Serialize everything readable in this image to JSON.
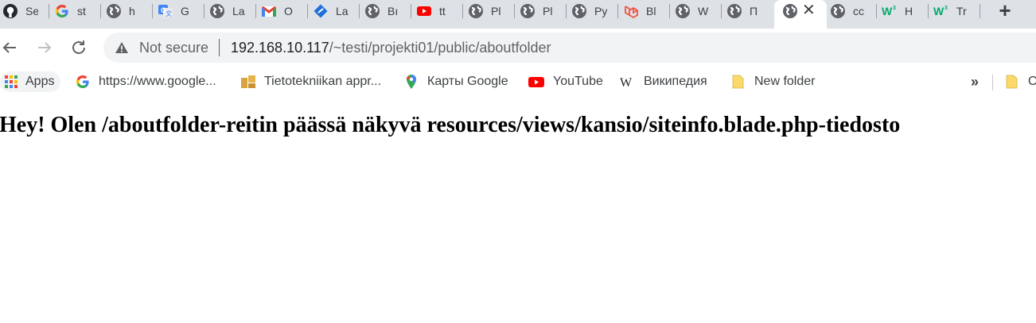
{
  "tabs": [
    {
      "title": "Se",
      "icon": "github-icon"
    },
    {
      "title": "st",
      "icon": "google-icon"
    },
    {
      "title": "h",
      "icon": "globe-icon"
    },
    {
      "title": "G",
      "icon": "google-translate-icon"
    },
    {
      "title": "La",
      "icon": "globe-icon"
    },
    {
      "title": "O",
      "icon": "gmail-icon"
    },
    {
      "title": "La",
      "icon": "blue-diamond-icon"
    },
    {
      "title": "Bı",
      "icon": "globe-icon"
    },
    {
      "title": "tt",
      "icon": "youtube-icon"
    },
    {
      "title": "Pl",
      "icon": "globe-icon"
    },
    {
      "title": "Pl",
      "icon": "globe-icon"
    },
    {
      "title": "Py",
      "icon": "globe-icon"
    },
    {
      "title": "Bl",
      "icon": "laravel-icon"
    },
    {
      "title": "W",
      "icon": "globe-icon"
    },
    {
      "title": "П",
      "icon": "globe-icon"
    },
    {
      "title": "cc",
      "icon": "globe-icon"
    },
    {
      "title": "H",
      "icon": "w3schools-icon"
    },
    {
      "title": "Tr",
      "icon": "w3schools-icon"
    }
  ],
  "active_tab": {
    "icon": "globe-icon",
    "close": "✕"
  },
  "new_tab_label": "+",
  "omnibox": {
    "security_label": "Not secure",
    "url_host": "192.168.10.117",
    "url_path": "/~testi/projekti01/public/aboutfolder"
  },
  "bookmarks": {
    "apps": "Apps",
    "items": [
      {
        "label": "https://www.google...",
        "icon": "google-icon"
      },
      {
        "label": "Tietotekniikan appr...",
        "icon": "bookmark-image-icon"
      },
      {
        "label": "Карты Google",
        "icon": "google-maps-icon"
      },
      {
        "label": "YouTube",
        "icon": "youtube-icon"
      },
      {
        "label": "Википедия",
        "icon": "wikipedia-icon"
      },
      {
        "label": "New folder",
        "icon": "folder-icon"
      }
    ],
    "overflow": "»",
    "trailing_folder_label": "O"
  },
  "colors": {
    "tabstrip": "#dee1e6",
    "omnibox": "#f1f3f4",
    "youtube_red": "#ff0000",
    "folder_yellow": "#fbd96b"
  },
  "page": {
    "heading": "Hey! Olen /aboutfolder-reitin päässä näkyvä resources/views/kansio/siteinfo.blade.php-tiedosto"
  }
}
